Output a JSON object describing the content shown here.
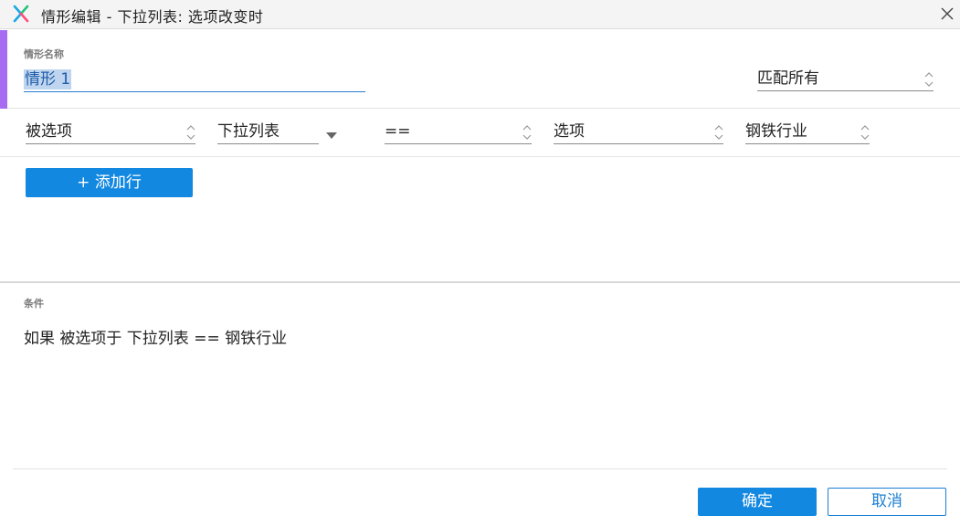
{
  "window": {
    "title": "情形编辑   -   下拉列表: 选项改变时",
    "accent_color": "#a66bf0",
    "primary_color": "#1288e0"
  },
  "case_name": {
    "label": "情形名称",
    "value": "情形 1",
    "match_mode": "匹配所有"
  },
  "condition_row": {
    "subject": "被选项",
    "target": "下拉列表",
    "operator": "==",
    "value_type": "选项",
    "value": "钢铁行业"
  },
  "add_row_label": "+ 添加行",
  "condition_section": {
    "label": "条件",
    "text": "如果  被选项于 下拉列表 == 钢铁行业"
  },
  "footer": {
    "ok_label": "确定",
    "cancel_label": "取消"
  }
}
